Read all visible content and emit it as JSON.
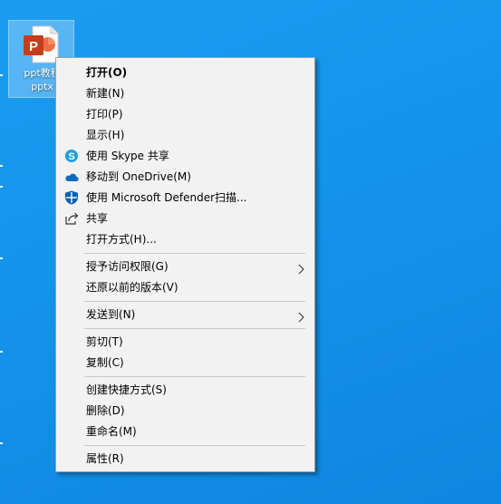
{
  "desktop": {
    "file_name_line1": "ppt教程",
    "file_name_line2": "pptx",
    "file_icon": "powerpoint-file-icon",
    "background_color": "#1493ea"
  },
  "menu": {
    "items": [
      {
        "label": "打开(O)",
        "bold": true
      },
      {
        "label": "新建(N)"
      },
      {
        "label": "打印(P)"
      },
      {
        "label": "显示(H)"
      },
      {
        "label": "使用 Skype 共享",
        "icon": "skype-icon"
      },
      {
        "label": "移动到 OneDrive(M)",
        "icon": "onedrive-cloud-icon"
      },
      {
        "label": "使用 Microsoft Defender扫描...",
        "icon": "defender-shield-icon"
      },
      {
        "label": "共享",
        "icon": "share-icon"
      },
      {
        "label": "打开方式(H)..."
      },
      {
        "label": "授予访问权限(G)",
        "submenu": true
      },
      {
        "label": "还原以前的版本(V)"
      },
      {
        "label": "发送到(N)",
        "submenu": true
      },
      {
        "label": "剪切(T)"
      },
      {
        "label": "复制(C)"
      },
      {
        "label": "创建快捷方式(S)"
      },
      {
        "label": "删除(D)"
      },
      {
        "label": "重命名(M)"
      },
      {
        "label": "属性(R)"
      }
    ]
  }
}
